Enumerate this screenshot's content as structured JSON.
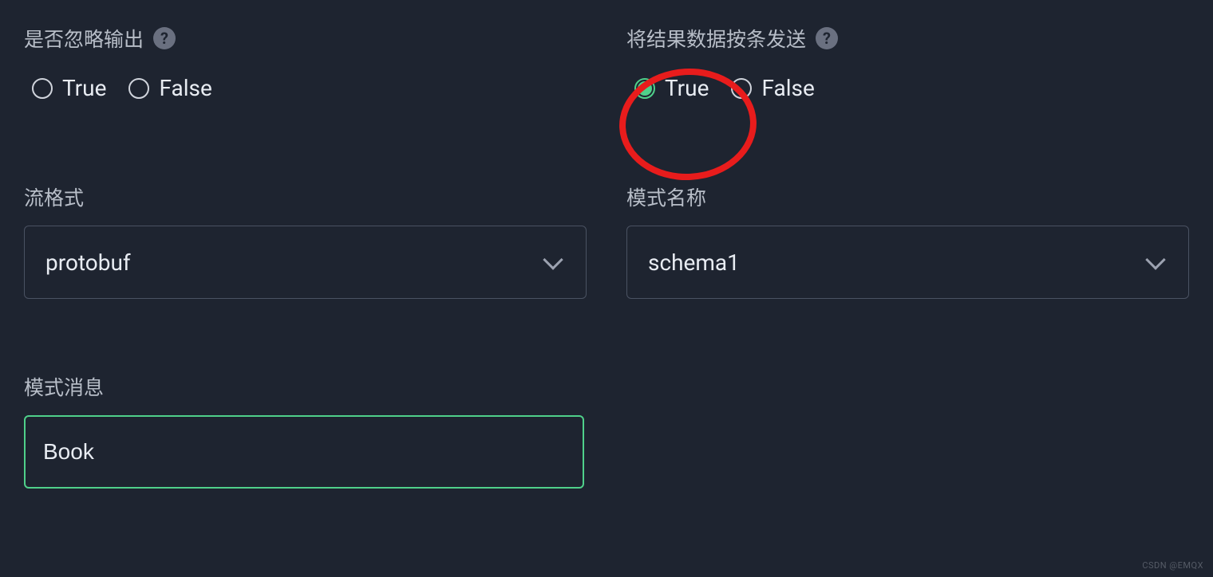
{
  "fields": {
    "ignoreOutput": {
      "label": "是否忽略输出",
      "options": {
        "true": "True",
        "false": "False"
      },
      "selected": null
    },
    "sendSingle": {
      "label": "将结果数据按条发送",
      "options": {
        "true": "True",
        "false": "False"
      },
      "selected": "true"
    },
    "streamFormat": {
      "label": "流格式",
      "value": "protobuf"
    },
    "schemaName": {
      "label": "模式名称",
      "value": "schema1"
    },
    "schemaMessage": {
      "label": "模式消息",
      "value": "Book"
    }
  },
  "helpGlyph": "?",
  "watermark": "CSDN @EMQX"
}
